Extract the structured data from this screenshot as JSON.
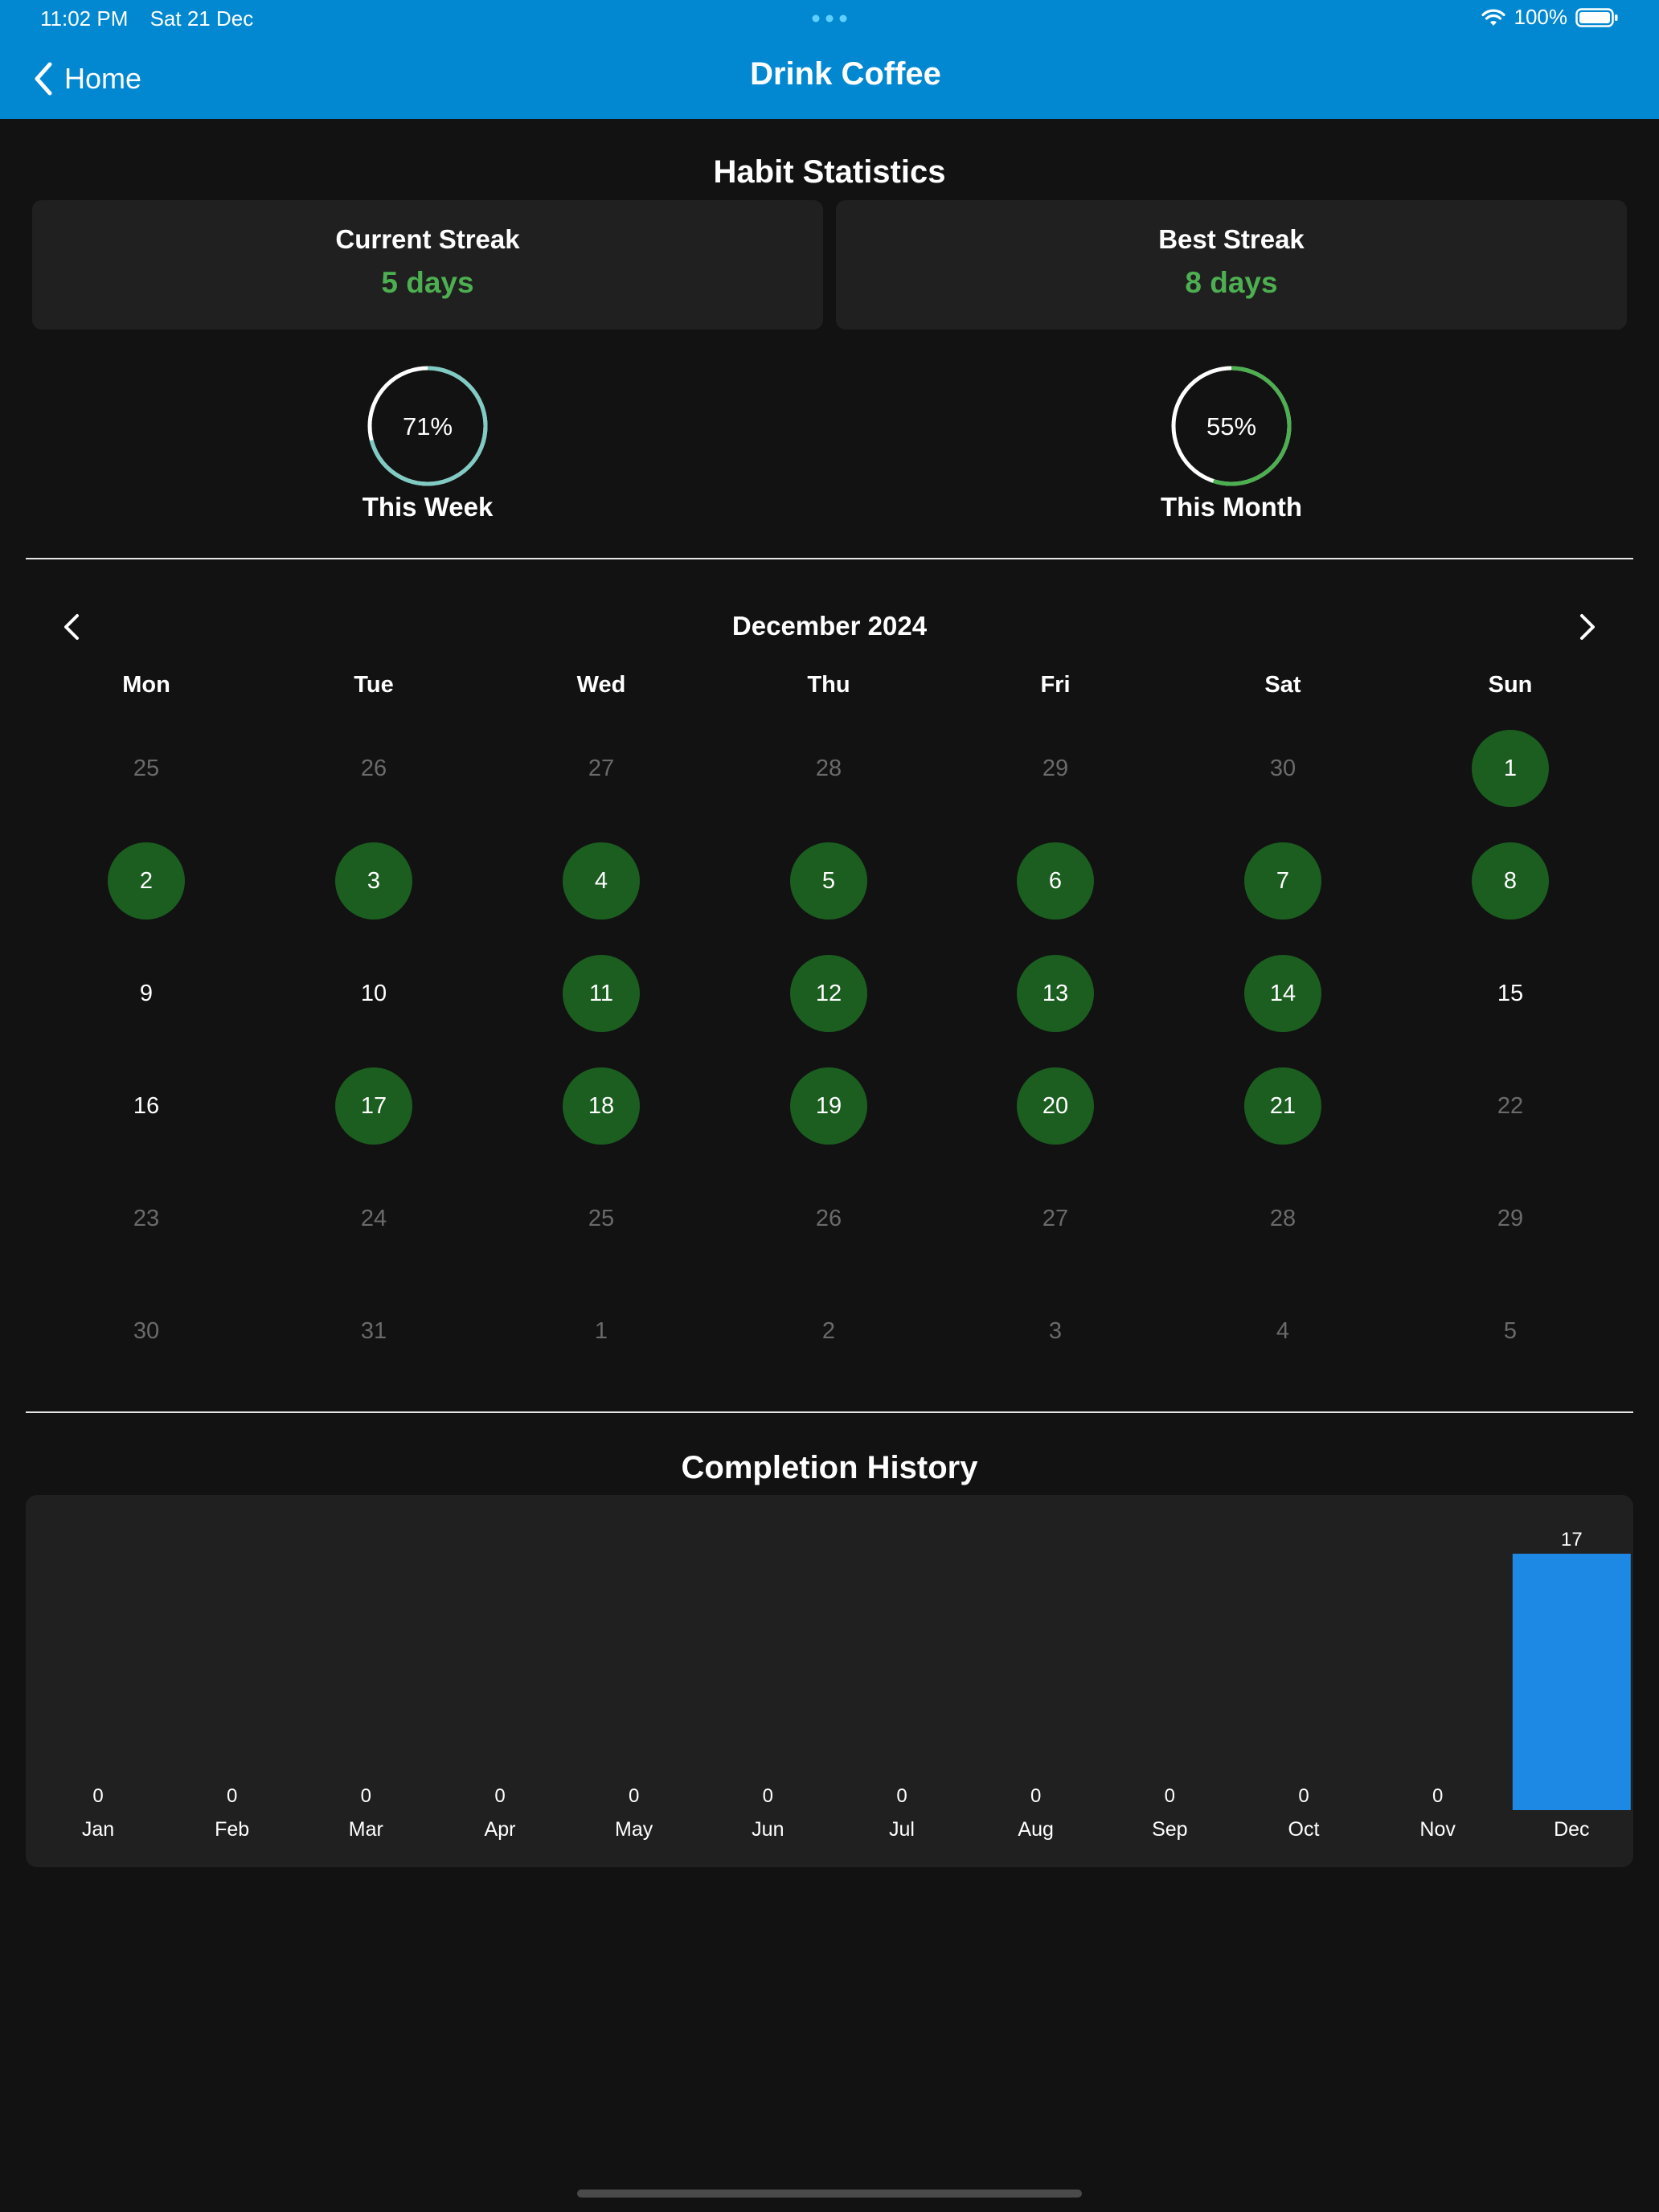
{
  "status_bar": {
    "time": "11:02 PM",
    "date": "Sat 21 Dec",
    "battery": "100%"
  },
  "nav": {
    "back_label": "Home",
    "title": "Drink Coffee"
  },
  "stats": {
    "title": "Habit Statistics",
    "current_streak_label": "Current Streak",
    "current_streak_value": "5 days",
    "best_streak_label": "Best Streak",
    "best_streak_value": "8 days",
    "week_percent": 0.71,
    "week_percent_label": "71%",
    "week_label": "This Week",
    "month_percent": 0.55,
    "month_percent_label": "55%",
    "month_label": "This Month"
  },
  "calendar": {
    "month_label": "December 2024",
    "weekdays": [
      "Mon",
      "Tue",
      "Wed",
      "Thu",
      "Fri",
      "Sat",
      "Sun"
    ],
    "weeks": [
      [
        {
          "d": "25",
          "s": "other"
        },
        {
          "d": "26",
          "s": "other"
        },
        {
          "d": "27",
          "s": "other"
        },
        {
          "d": "28",
          "s": "other"
        },
        {
          "d": "29",
          "s": "other"
        },
        {
          "d": "30",
          "s": "other"
        },
        {
          "d": "1",
          "s": "done"
        }
      ],
      [
        {
          "d": "2",
          "s": "done"
        },
        {
          "d": "3",
          "s": "done"
        },
        {
          "d": "4",
          "s": "done"
        },
        {
          "d": "5",
          "s": "done"
        },
        {
          "d": "6",
          "s": "done"
        },
        {
          "d": "7",
          "s": "done"
        },
        {
          "d": "8",
          "s": "done"
        }
      ],
      [
        {
          "d": "9",
          "s": "cur"
        },
        {
          "d": "10",
          "s": "cur"
        },
        {
          "d": "11",
          "s": "done"
        },
        {
          "d": "12",
          "s": "done"
        },
        {
          "d": "13",
          "s": "done"
        },
        {
          "d": "14",
          "s": "done"
        },
        {
          "d": "15",
          "s": "cur"
        }
      ],
      [
        {
          "d": "16",
          "s": "cur"
        },
        {
          "d": "17",
          "s": "done"
        },
        {
          "d": "18",
          "s": "done"
        },
        {
          "d": "19",
          "s": "done"
        },
        {
          "d": "20",
          "s": "done"
        },
        {
          "d": "21",
          "s": "done"
        },
        {
          "d": "22",
          "s": "other"
        }
      ],
      [
        {
          "d": "23",
          "s": "other"
        },
        {
          "d": "24",
          "s": "other"
        },
        {
          "d": "25",
          "s": "other"
        },
        {
          "d": "26",
          "s": "other"
        },
        {
          "d": "27",
          "s": "other"
        },
        {
          "d": "28",
          "s": "other"
        },
        {
          "d": "29",
          "s": "other"
        }
      ],
      [
        {
          "d": "30",
          "s": "other"
        },
        {
          "d": "31",
          "s": "other"
        },
        {
          "d": "1",
          "s": "other"
        },
        {
          "d": "2",
          "s": "other"
        },
        {
          "d": "3",
          "s": "other"
        },
        {
          "d": "4",
          "s": "other"
        },
        {
          "d": "5",
          "s": "other"
        }
      ]
    ]
  },
  "history": {
    "title": "Completion History"
  },
  "chart_data": {
    "type": "bar",
    "title": "Completion History",
    "categories": [
      "Jan",
      "Feb",
      "Mar",
      "Apr",
      "May",
      "Jun",
      "Jul",
      "Aug",
      "Sep",
      "Oct",
      "Nov",
      "Dec"
    ],
    "values": [
      0,
      0,
      0,
      0,
      0,
      0,
      0,
      0,
      0,
      0,
      0,
      17
    ],
    "data_labels": [
      "0",
      "0",
      "0",
      "0",
      "0",
      "0",
      "0",
      "0",
      "0",
      "0",
      "0",
      "17"
    ],
    "ylim": [
      0,
      17
    ],
    "grid": false,
    "bar_color": "#1E88E5"
  },
  "colors": {
    "header": "#0288D1",
    "background": "#121212",
    "card": "#202020",
    "accent_green": "#4CAF50",
    "completed_day": "#1B5E20",
    "week_ring": "#80CBC4",
    "month_ring": "#4CAF50"
  },
  "icons": {
    "back": "chevron-left-icon",
    "prev": "chevron-left-icon",
    "next": "chevron-right-icon",
    "wifi": "wifi-icon",
    "battery": "battery-icon"
  }
}
